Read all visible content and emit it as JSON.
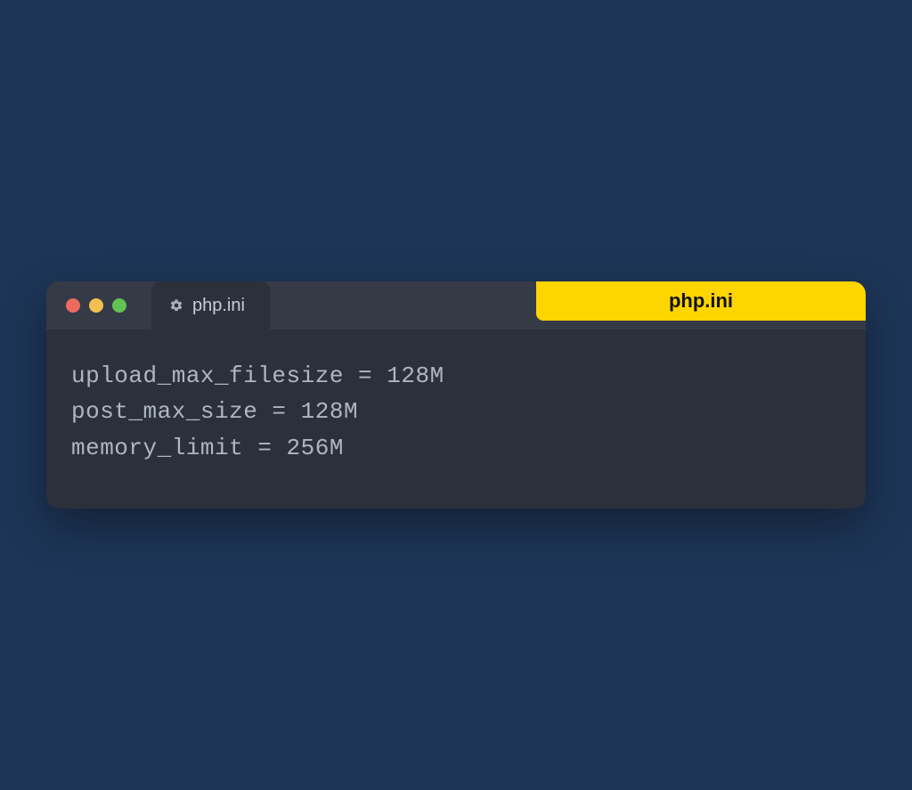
{
  "colors": {
    "background": "#1d3557",
    "window_bg": "#2b303b",
    "titlebar_bg": "#353a47",
    "badge_bg": "#ffd500",
    "traffic_red": "#ed6a5e",
    "traffic_yellow": "#f5bf4f",
    "traffic_green": "#61c354",
    "text": "#aeb6c4"
  },
  "tab": {
    "label": "php.ini",
    "icon": "gear-icon"
  },
  "badge": {
    "label": "php.ini"
  },
  "editor": {
    "lines": [
      "upload_max_filesize = 128M",
      "post_max_size = 128M",
      "memory_limit = 256M"
    ]
  }
}
